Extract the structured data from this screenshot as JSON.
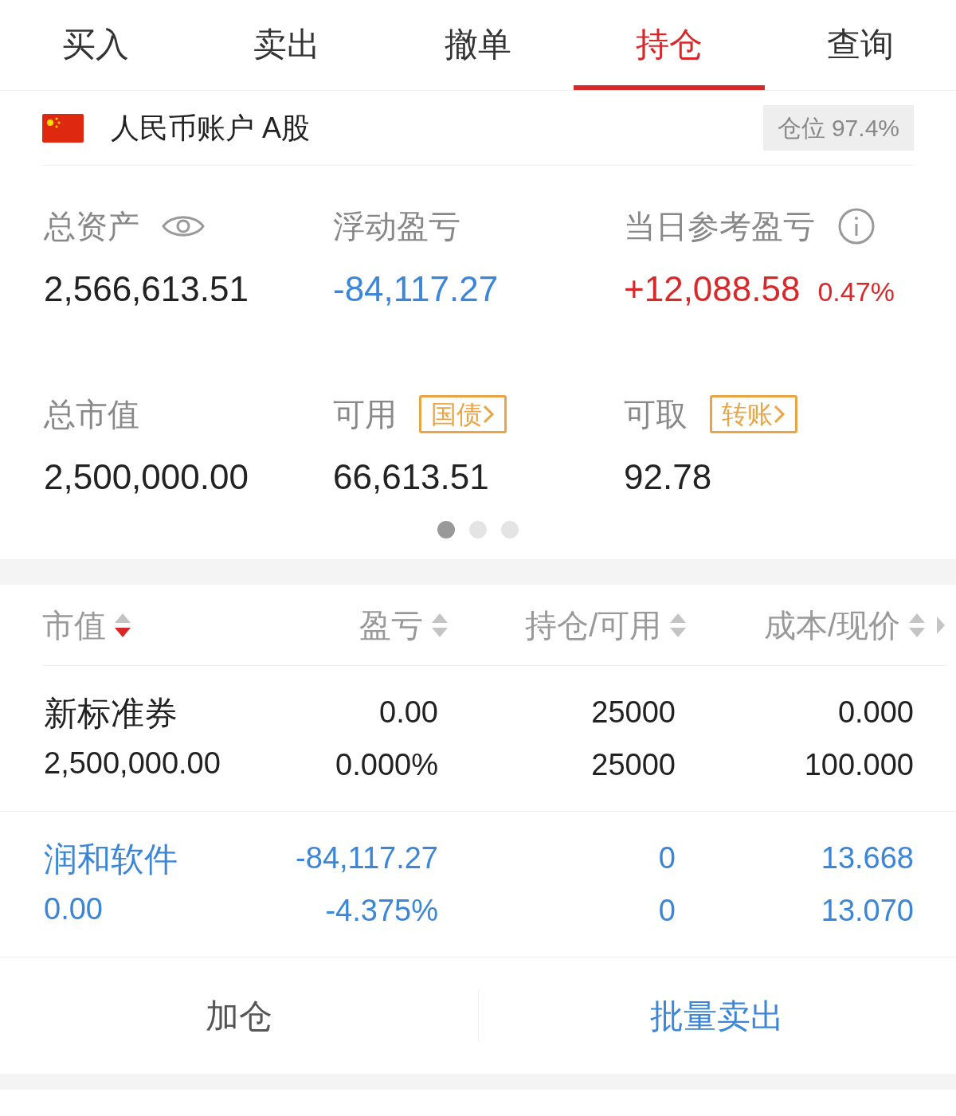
{
  "tabs": [
    {
      "label": "买入",
      "selected": false
    },
    {
      "label": "卖出",
      "selected": false
    },
    {
      "label": "撤单",
      "selected": false
    },
    {
      "label": "持仓",
      "selected": true
    },
    {
      "label": "查询",
      "selected": false
    }
  ],
  "account": {
    "name": "人民币账户 A股",
    "position": "仓位 97.4%"
  },
  "summary": [
    {
      "kind": "eye",
      "label": "总资产",
      "value": "2,566,613.51",
      "color": "#222222"
    },
    {
      "kind": "plain",
      "label": "浮动盈亏",
      "value": "-84,117.27",
      "color": "#3b86d8"
    },
    {
      "kind": "info",
      "label": "当日参考盈亏",
      "value": "+12,088.58",
      "extra": "0.47%",
      "color": "#d8282a"
    },
    {
      "kind": "plain",
      "label": "总市值",
      "value": "2,500,000.00",
      "color": "#222222"
    },
    {
      "kind": "badge",
      "label": "可用",
      "badge": "国债",
      "value": "66,613.51",
      "color": "#222222"
    },
    {
      "kind": "badge",
      "label": "可取",
      "badge": "转账",
      "value": "92.78",
      "color": "#222222"
    }
  ],
  "pager": [
    {
      "selected": true
    },
    {
      "selected": false
    },
    {
      "selected": false
    }
  ],
  "columns": [
    {
      "label": "市值",
      "sorted": true
    },
    {
      "label": "盈亏",
      "sorted": false
    },
    {
      "label": "持仓/可用",
      "sorted": false
    },
    {
      "label": "成本/现价",
      "sorted": false
    }
  ],
  "rows": [
    {
      "name": "新标准券",
      "market_value": "2,500,000.00",
      "pnl": "0.00",
      "pnl_pct": "0.000%",
      "holding": "25000",
      "available": "25000",
      "cost": "0.000",
      "price": "100.000",
      "color": "#222222"
    },
    {
      "name": "润和软件",
      "market_value": "0.00",
      "pnl": "-84,117.27",
      "pnl_pct": "-4.375%",
      "holding": "0",
      "available": "0",
      "cost": "13.668",
      "price": "13.070",
      "color": "#3b86d8"
    }
  ],
  "actions": [
    {
      "label": "加仓",
      "color": "#555555"
    },
    {
      "label": "批量卖出",
      "color": "#3b86d8"
    }
  ]
}
